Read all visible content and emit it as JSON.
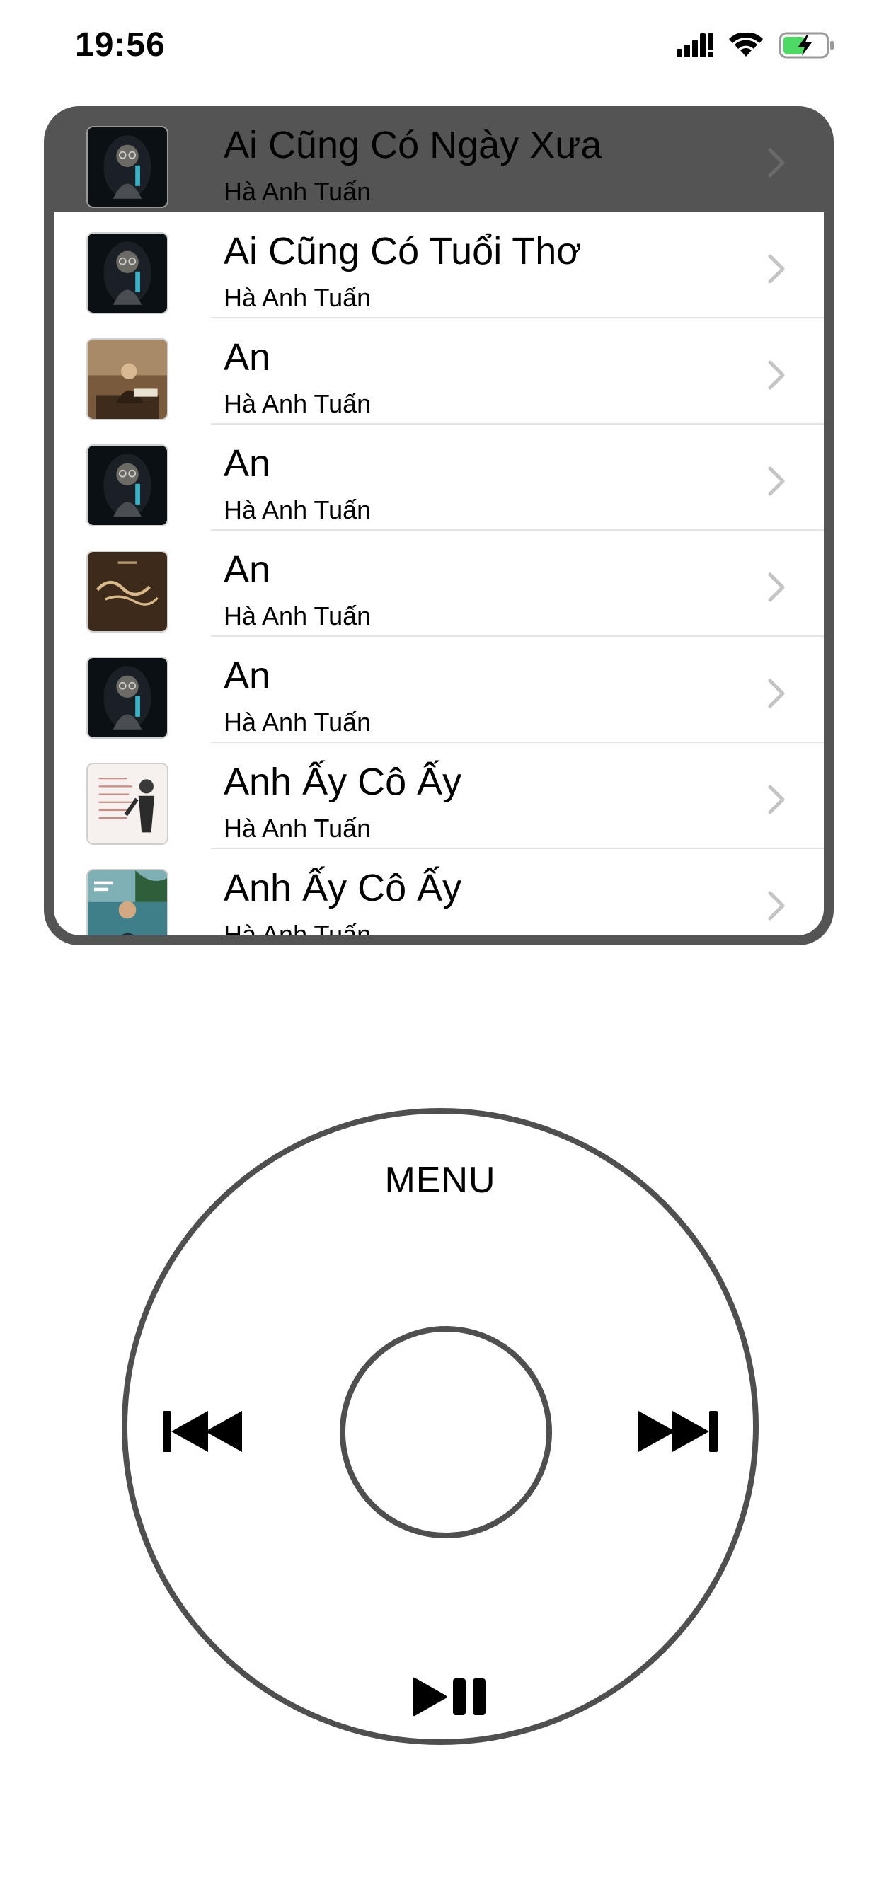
{
  "status_bar": {
    "time": "19:56",
    "icons": [
      "cellular-signal-icon",
      "wifi-icon",
      "battery-charging-icon"
    ],
    "battery_color": "#4cd964"
  },
  "screen": {
    "bezel_color": "#545454",
    "songs": [
      {
        "title": "Ai Cũng Có Ngày Xưa",
        "artist": "Hà Anh Tuấn",
        "art": "dark-portrait",
        "selected": true
      },
      {
        "title": "Ai Cũng Có Tuổi Thơ",
        "artist": "Hà Anh Tuấn",
        "art": "dark-portrait",
        "selected": false
      },
      {
        "title": "An",
        "artist": "Hà Anh Tuấn",
        "art": "sepia-photo",
        "selected": false
      },
      {
        "title": "An",
        "artist": "Hà Anh Tuấn",
        "art": "dark-portrait",
        "selected": false
      },
      {
        "title": "An",
        "artist": "Hà Anh Tuấn",
        "art": "brown-script",
        "selected": false
      },
      {
        "title": "An",
        "artist": "Hà Anh Tuấn",
        "art": "dark-portrait",
        "selected": false
      },
      {
        "title": "Anh Ấy Cô Ấy",
        "artist": "Hà Anh Tuấn",
        "art": "white-sketch",
        "selected": false
      },
      {
        "title": "Anh Ấy Cô Ấy",
        "artist": "Hà Anh Tuấn",
        "art": "teal-photo",
        "selected": false
      }
    ]
  },
  "wheel": {
    "menu_label": "MENU",
    "icons": {
      "previous": "previous-track-icon",
      "next": "next-track-icon",
      "play_pause": "play-pause-icon"
    }
  }
}
